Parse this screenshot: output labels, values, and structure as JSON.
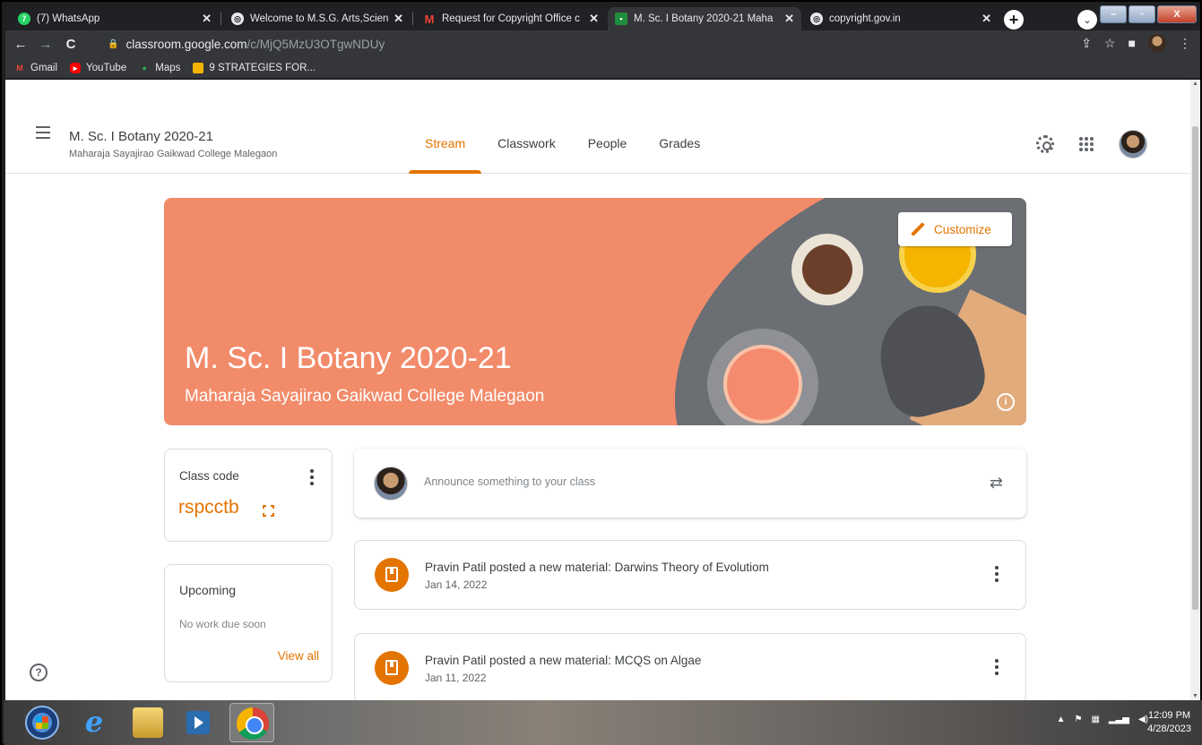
{
  "browser": {
    "tabs": [
      {
        "title": "(7) WhatsApp",
        "icon": "whatsapp-icon",
        "color": "#25d366",
        "active": false
      },
      {
        "title": "Welcome to M.S.G. Arts,Scienc",
        "icon": "globe-icon",
        "color": "#e8eaed",
        "active": false
      },
      {
        "title": "Request for Copyright Office c",
        "icon": "gmail-icon",
        "color": "#ea4335",
        "active": false
      },
      {
        "title": "M. Sc. I Botany 2020-21 Maha",
        "icon": "classroom-icon",
        "color": "#1e8e3e",
        "active": true
      },
      {
        "title": "copyright.gov.in",
        "icon": "globe-icon",
        "color": "#e8eaed",
        "active": false
      }
    ],
    "url_host": "classroom.google.com",
    "url_path": "/c/MjQ5MzU3OTgwNDUy",
    "bookmarks": [
      {
        "label": "Gmail",
        "icon": "gmail-icon",
        "color": "#ea4335"
      },
      {
        "label": "YouTube",
        "icon": "youtube-icon",
        "color": "#ff0000"
      },
      {
        "label": "Maps",
        "icon": "maps-icon",
        "color": "#34a853"
      },
      {
        "label": "9 STRATEGIES FOR...",
        "icon": "slides-icon",
        "color": "#f4b400"
      }
    ]
  },
  "header": {
    "class_name": "M. Sc. I Botany 2020-21",
    "class_section": "Maharaja Sayajirao Gaikwad College Malegaon",
    "tabs": [
      "Stream",
      "Classwork",
      "People",
      "Grades"
    ],
    "active_tab": "Stream"
  },
  "banner": {
    "title": "M. Sc. I Botany 2020-21",
    "subtitle": "Maharaja Sayajirao Gaikwad College Malegaon",
    "customize_label": "Customize",
    "background_color": "#f28b6a"
  },
  "class_code": {
    "label": "Class code",
    "code": "rspcctb"
  },
  "upcoming": {
    "label": "Upcoming",
    "empty_text": "No work due soon",
    "view_all": "View all"
  },
  "announce": {
    "placeholder": "Announce something to your class"
  },
  "posts": [
    {
      "title": "Pravin Patil posted a new material: Darwins Theory of Evolutiom",
      "date": "Jan 14, 2022"
    },
    {
      "title": "Pravin Patil posted a new material: MCQS on Algae",
      "date": "Jan 11, 2022"
    }
  ],
  "taskbar": {
    "time": "12:09 PM",
    "date": "4/28/2023"
  },
  "colors": {
    "accent": "#e37400"
  }
}
